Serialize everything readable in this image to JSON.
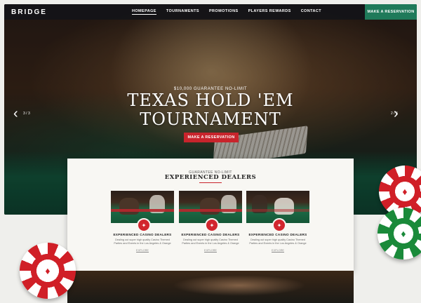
{
  "brand": {
    "logo": "BRIDGE",
    "accent": "#c8242c",
    "green": "#1f7a5a"
  },
  "nav": {
    "items": [
      {
        "label": "HOMEPAGE",
        "active": true
      },
      {
        "label": "TOURNAMENTS",
        "active": false
      },
      {
        "label": "PROMOTIONS",
        "active": false
      },
      {
        "label": "PLAYERS REWARDS",
        "active": false
      },
      {
        "label": "CONTACT",
        "active": false
      }
    ],
    "cta": "MAKE A RESERVATION"
  },
  "hero": {
    "kicker": "$10,000 GUARANTEE NO-LIMIT",
    "title_line1": "TEXAS HOLD 'EM",
    "title_line2": "TOURNAMENT",
    "button": "MAKE A RESERVATION",
    "counter_left": "3 / 3",
    "counter_right": "2 / 3"
  },
  "section": {
    "sub": "GUARANTEE NO-LIMIT",
    "heading": "EXPERIENCED DEALERS",
    "cards": [
      {
        "title": "EXPERIENCED CASINO DEALERS",
        "text_l1": "Dealing out super high quality Casino Themed",
        "text_l2": "Parties and Events in the Los Angeles & Orange",
        "link": "EXPLORE"
      },
      {
        "title": "EXPERIENCED CASINO DEALERS",
        "text_l1": "Dealing out super high quality Casino Themed",
        "text_l2": "Parties and Events in the Los Angeles & Orange",
        "link": "EXPLORE"
      },
      {
        "title": "EXPERIENCED CASINO DEALERS",
        "text_l1": "Dealing out super high quality Casino Themed",
        "text_l2": "Parties and Events in the Los Angeles & Orange",
        "link": "EXPLORE"
      }
    ]
  },
  "icons": {
    "card_badge": "chip-icon",
    "arrow_left": "chevron-left-icon",
    "arrow_right": "chevron-right-icon"
  }
}
